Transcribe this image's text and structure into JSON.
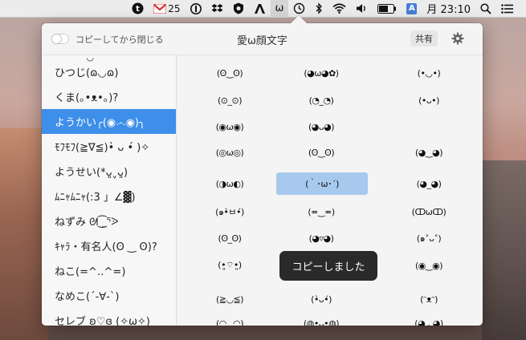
{
  "menubar": {
    "gmail_count": "25",
    "ime_label": "A",
    "clock": "月 23:10",
    "kaomoji_icon": "ω"
  },
  "popover": {
    "toggle_label": "コピーしてから閉じる",
    "title": "愛ω顔文字",
    "share_label": "共有",
    "toast": "コピーしました"
  },
  "sidebar": {
    "top_clip": "˙◡˙",
    "items": [
      {
        "label": "ひつじ(ɷ◡ɷ)"
      },
      {
        "label": "くま(｡•ᴥ•｡)?"
      },
      {
        "label": "ようかい╭(◉෴◉)╮"
      },
      {
        "label": "ﾓﾌﾓﾌ(≧∇≦)•̀ ᴗ •́ )✧"
      },
      {
        "label": "ようせい(*ᴗ͈ˬᴗ͈)"
      },
      {
        "label": "ﾑﾆｬﾑﾆｬ(:3 」∠▓)"
      },
      {
        "label": "ねずみ ᘛ⁐̤ᕐᐷ"
      },
      {
        "label": "ｷｬﾗ・有名人(ʘ ‿ ʘ)?"
      },
      {
        "label": "ねこ(=^‥^=)"
      },
      {
        "label": "なめこ(´-∀-`)"
      },
      {
        "label": "セレブ ʚ♡ɞ (✧ω✧)"
      }
    ]
  },
  "grid": [
    [
      "(ʘ‿ʘ)",
      "(◕ω◕✿)",
      "(•◡•)"
    ],
    [
      "(⊙_⊙)",
      "(◔_◔)",
      "(•ᴗ•)"
    ],
    [
      "(◉ω◉)",
      "(◕ᴗ◕)",
      "(=ↀωↀ=)"
    ],
    [
      "(◎ω◎)",
      "(ʘ‿ʘ)",
      "(◕‿◕)"
    ],
    [
      "(◑ω◐)",
      "(｀･ω･´)",
      "(◕_◕)"
    ],
    [
      "(๑•̀ㅂ•́)",
      "(≖‿≖)",
      "(ↀωↀ)"
    ],
    [
      "(ʘ_ʘ)",
      "(◕▿◕)",
      "(๑˃ᴗ˂)"
    ],
    [
      "(•͈⌔•͈)",
      "",
      "(◉‿◉)"
    ],
    [
      "(◔‿◔)",
      "(◕ᴥ◕)",
      "(ʘωʘ)"
    ],
    [
      "(≧◡≦)",
      "(•̀ᴗ•́)",
      "(ᵔᴥᵔ)"
    ],
    [
      "(◠‿◠)",
      "(◍•ᴗ•◍)",
      "(◕ᆺ◕)"
    ]
  ]
}
